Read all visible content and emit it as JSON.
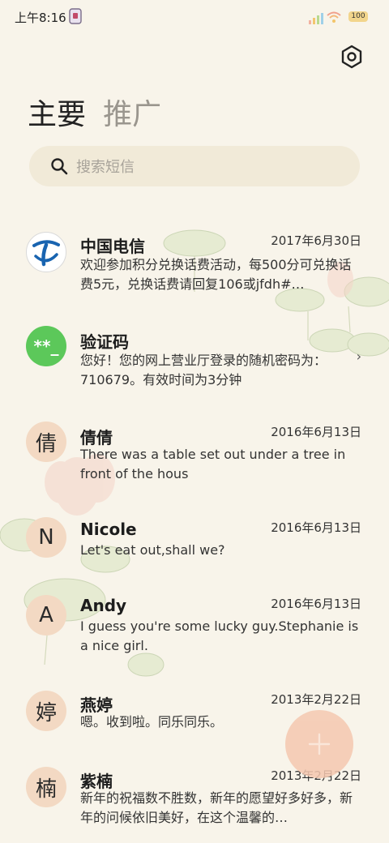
{
  "status_bar": {
    "time": "上午8:16",
    "battery": "100"
  },
  "tabs": [
    {
      "label": "主要"
    },
    {
      "label": "推广"
    }
  ],
  "search": {
    "placeholder": "搜索短信"
  },
  "messages": [
    {
      "name": "中国电信",
      "date": "2017年6月30日",
      "text": "欢迎参加积分兑换话费活动，每500分可兑换话费5元，兑换话费请回复106或jfdh#…",
      "avatar": "telecom-logo"
    },
    {
      "name": "验证码",
      "date": "",
      "text": "您好！您的网上营业厅登录的随机密码为：710679。有效时间为3分钟",
      "avatar_text": "**_"
    },
    {
      "name": "倩倩",
      "date": "2016年6月13日",
      "text": "There was a table set out under a tree in front of the hous",
      "avatar_text": "倩"
    },
    {
      "name": "Nicole",
      "date": "2016年6月13日",
      "text": "Let's eat out,shall we?",
      "avatar_text": "N"
    },
    {
      "name": "Andy",
      "date": "2016年6月13日",
      "text": "I guess you're some lucky guy.Stephanie is a nice girl.",
      "avatar_text": "A"
    },
    {
      "name": "燕婷",
      "date": "2013年2月22日",
      "text": "嗯。收到啦。同乐同乐。",
      "avatar_text": "婷"
    },
    {
      "name": "紫楠",
      "date": "2013年2月22日",
      "text": "新年的祝福数不胜数，新年的愿望好多好多，新年的问候依旧美好，在这个温馨的…",
      "avatar_text": "楠"
    }
  ],
  "colors": {
    "background": "#f8f4ea",
    "avatar_letter": "#f3d9c3",
    "verify_avatar": "#5cc85a",
    "fab": "#f5c8b0"
  },
  "icons": {
    "settings": "settings-icon",
    "search": "search-icon",
    "compose": "plus-icon",
    "chevron": "chevron-right-icon"
  }
}
